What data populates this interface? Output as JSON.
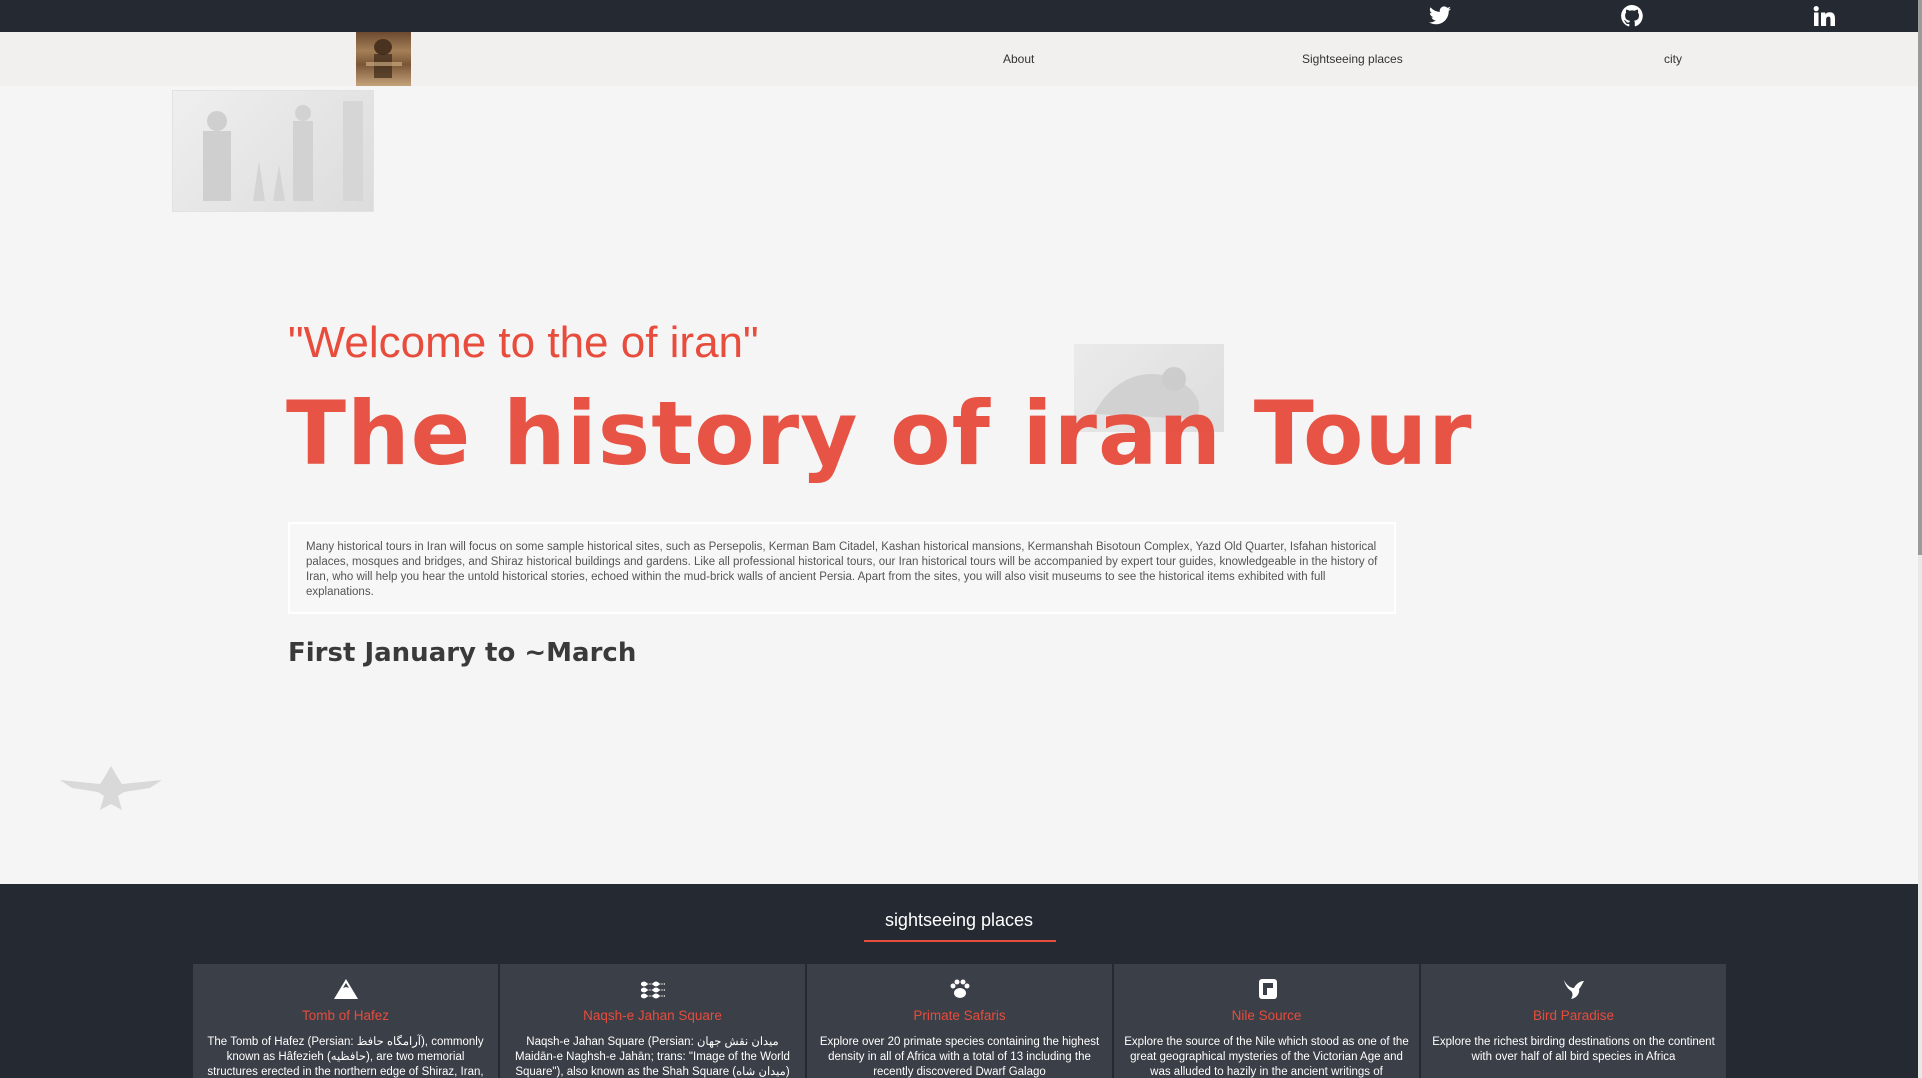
{
  "topbar": {
    "icons": [
      "twitter-icon",
      "github-icon",
      "linkedin-icon"
    ]
  },
  "nav": {
    "links": [
      "About",
      "Sightseeing places",
      "city"
    ]
  },
  "hero": {
    "welcome": "\"Welcome to the of iran\"",
    "title": "The history of iran Tour",
    "intro": "Many historical tours in Iran will focus on some sample historical sites, such as Persepolis, Kerman Bam Citadel, Kashan historical mansions, Kermanshah Bisotoun Complex, Yazd Old Quarter, Isfahan historical palaces, mosques and bridges, and Shiraz historical buildings and gardens. Like all professional historical tours, our Iran historical tours will be accompanied by expert tour guides, knowledgeable in the history of Iran, who will help you hear the untold historical stories, echoed within the mud-brick walls of ancient Persia. Apart from the sites, you will also visit museums to see the historical items exhibited with full explanations.",
    "dates": "First January to ~March"
  },
  "sightseeing": {
    "title": "sightseeing places",
    "accent_color": "#e74c3c",
    "cards": [
      {
        "icon": "mountain-icon",
        "title": "Tomb of Hafez",
        "desc": "The Tomb of Hafez (Persian: آرامگاه حافظ), commonly known as Hâfezieh (حافظیه), are two memorial structures erected in the northern edge of Shiraz, Iran,"
      },
      {
        "icon": "waves-icon",
        "title": "Naqsh-e Jahan Square",
        "desc": "Naqsh-e Jahan Square (Persian: میدان نقش جهان Maidān-e Naghsh-e Jahān; trans: \"Image of the World Square\"), also known as the Shah Square (میدان شاه)"
      },
      {
        "icon": "paw-icon",
        "title": "Primate Safaris",
        "desc": "Explore over 20 primate species containing the highest density in all of Africa with a total of 13 including the recently discovered Dwarf Galago"
      },
      {
        "icon": "flag-icon",
        "title": "Nile Source",
        "desc": "Explore the source of the Nile which stood as one of the great geographical mysteries of the Victorian Age and was alluded to hazily in the ancient writings of"
      },
      {
        "icon": "bird-icon",
        "title": "Bird Paradise",
        "desc": "Explore the richest birding destinations on the continent with over half of all bird species in Africa"
      }
    ]
  }
}
